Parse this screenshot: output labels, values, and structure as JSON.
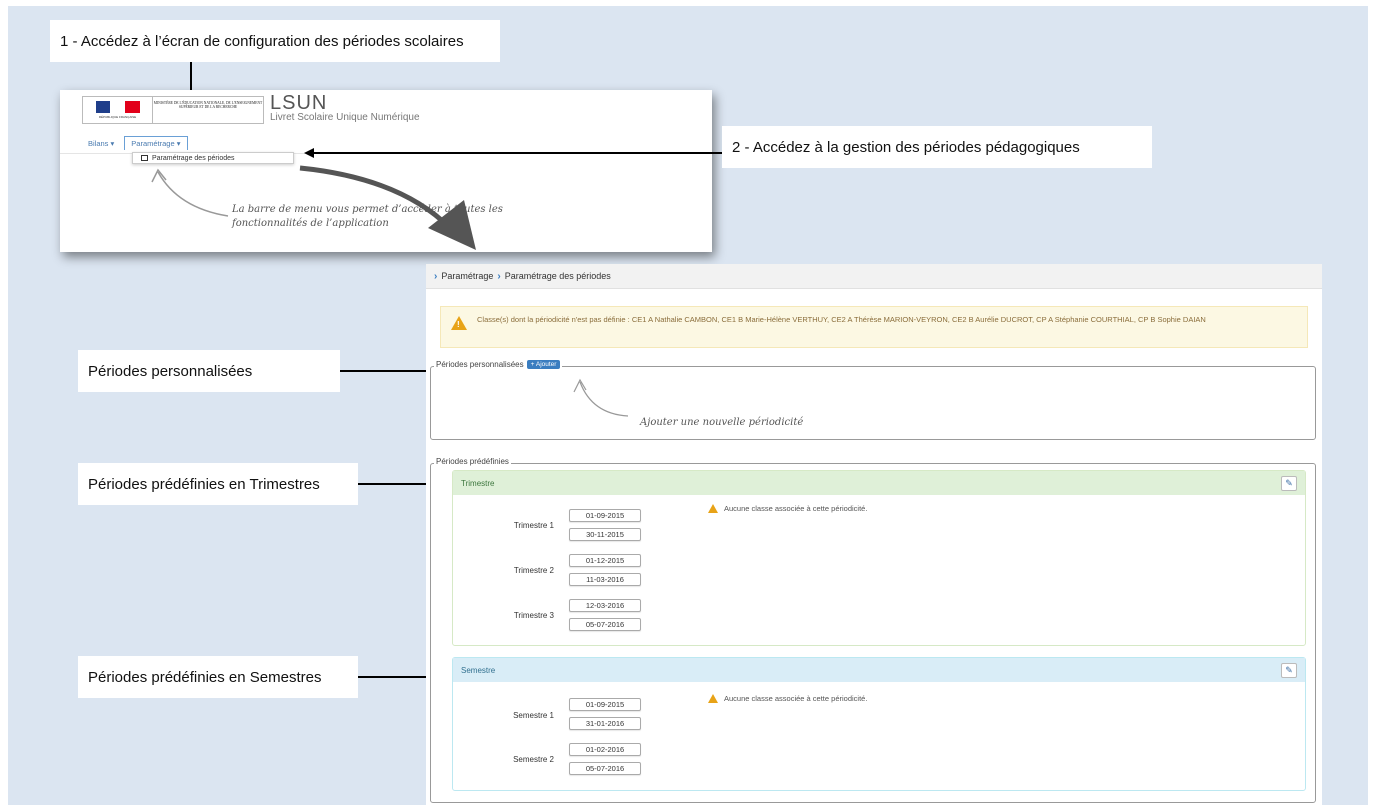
{
  "callouts": {
    "step1": "1 - Accédez à l’écran de configuration des périodes scolaires",
    "step2": "2 - Accédez à la gestion des périodes pédagogiques",
    "perso": "Périodes personnalisées",
    "trim": "Périodes prédéfinies en Trimestres",
    "sem": "Périodes prédéfinies en Semestres"
  },
  "app": {
    "logo_text": "MINISTÈRE DE L'ÉDUCATION NATIONALE, DE L'ENSEIGNEMENT SUPÉRIEUR ET DE LA RECHERCHE",
    "republic": "RÉPUBLIQUE FRANÇAISE",
    "name": "LSUN",
    "subtitle": "Livret Scolaire Unique Numérique",
    "menu_bilans": "Bilans ▾",
    "menu_parametrage": "Paramétrage ▾",
    "dropdown_item": "Paramétrage des périodes",
    "hand_note_line1": "La barre de menu vous permet d’accéder à toutes les",
    "hand_note_line2": "fonctionnalités de l’application"
  },
  "screen": {
    "breadcrumb_1": "Paramétrage",
    "breadcrumb_2": "Paramétrage des périodes",
    "warning": "Classe(s) dont la périodicité n'est pas définie : CE1 A Nathalie CAMBON, CE1 B Marie-Hélène VERTHUY, CE2 A Thérèse MARION-VEYRON, CE2 B Aurélie DUCROT, CP A Stéphanie COURTHIAL, CP B Sophie DAIAN",
    "perso_legend": "Périodes personnalisées",
    "add_button": "+ Ajouter",
    "add_hint": "Ajouter une nouvelle périodicité",
    "predef_legend": "Périodes prédéfinies",
    "no_class": "Aucune classe associée à cette périodicité.",
    "trimestre": {
      "title": "Trimestre",
      "rows": [
        {
          "label": "Trimestre 1",
          "start": "01-09-2015",
          "end": "30-11-2015"
        },
        {
          "label": "Trimestre 2",
          "start": "01-12-2015",
          "end": "11-03-2016"
        },
        {
          "label": "Trimestre 3",
          "start": "12-03-2016",
          "end": "05-07-2016"
        }
      ]
    },
    "semestre": {
      "title": "Semestre",
      "rows": [
        {
          "label": "Semestre 1",
          "start": "01-09-2015",
          "end": "31-01-2016"
        },
        {
          "label": "Semestre 2",
          "start": "01-02-2016",
          "end": "05-07-2016"
        }
      ]
    }
  },
  "colors": {
    "trim_head": "#dff0d8",
    "trim_title": "#3c763d",
    "sem_head": "#d9edf7",
    "sem_title": "#31708f"
  }
}
